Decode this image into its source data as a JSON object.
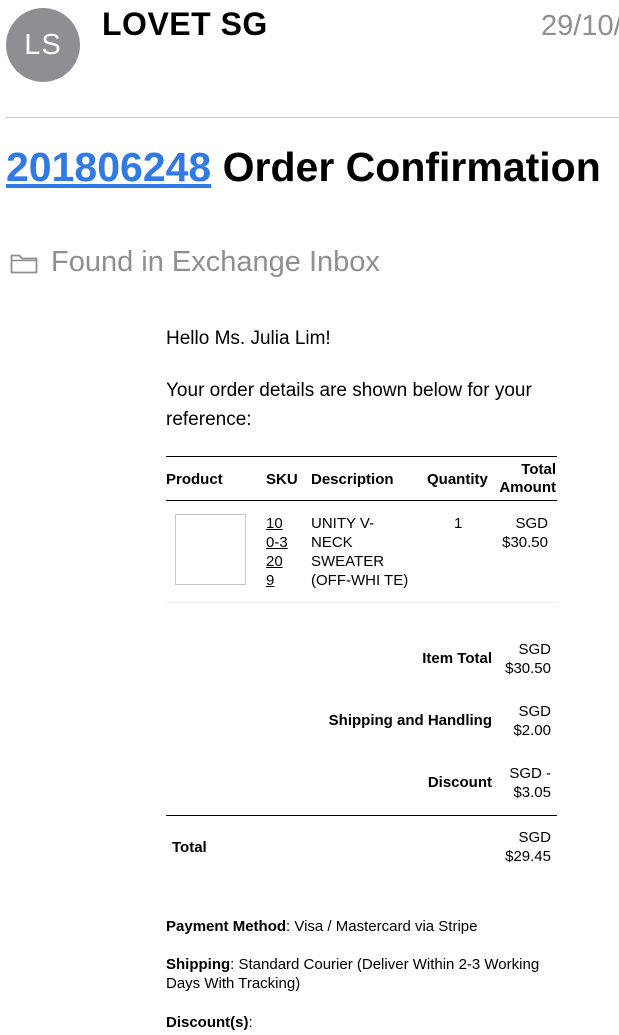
{
  "header": {
    "avatar_initials": "LS",
    "sender": "LOVET SG",
    "date": "29/10/"
  },
  "subject": {
    "order_number": "201806248",
    "title": " Order Confirmation"
  },
  "folder": {
    "icon": "folder-icon",
    "label": "Found in Exchange Inbox"
  },
  "email": {
    "greeting": "Hello Ms. Julia Lim!",
    "intro": "Your order details are shown below for your reference:",
    "table": {
      "headers": {
        "product": "Product",
        "sku": "SKU",
        "description": "Description",
        "quantity": "Quantity",
        "total_amount_line1": "Total",
        "total_amount_line2": "Amount"
      },
      "rows": [
        {
          "sku_lines": [
            "10",
            "0-3",
            "20",
            "9"
          ],
          "description_lines": [
            "UNITY V-",
            "NECK",
            "SWEATER",
            "(OFF-WHI TE)"
          ],
          "quantity": "1",
          "amount_lines": [
            "SGD",
            "$30.50"
          ]
        }
      ]
    },
    "summary": {
      "item_total_label": "Item Total",
      "item_total_lines": [
        "SGD",
        "$30.50"
      ],
      "shipping_label": "Shipping and Handling",
      "shipping_lines": [
        "SGD",
        "$2.00"
      ],
      "discount_label": "Discount",
      "discount_lines": [
        "SGD -",
        "$3.05"
      ],
      "total_label": "Total",
      "total_lines": [
        "SGD",
        "$29.45"
      ]
    },
    "payment": {
      "label": "Payment Method",
      "value": ": Visa / Mastercard via Stripe"
    },
    "shipping_method": {
      "label": "Shipping",
      "value": ": Standard Courier (Deliver Within 2-3 Working Days With Tracking)"
    },
    "discounts": {
      "label": "Discount(s)",
      "value": ":"
    }
  }
}
